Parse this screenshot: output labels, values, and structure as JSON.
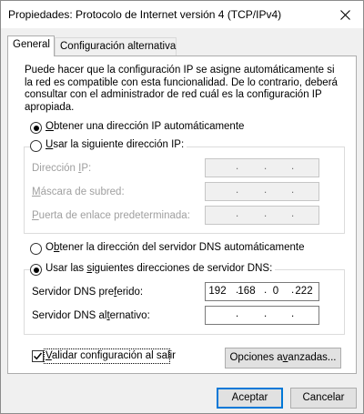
{
  "window": {
    "title": "Propiedades: Protocolo de Internet versión 4 (TCP/IPv4)"
  },
  "tabs": [
    {
      "label": "General",
      "active": true
    },
    {
      "label": "Configuración alternativa",
      "active": false
    }
  ],
  "description": "Puede hacer que la configuración IP se asigne automáticamente si la red es compatible con esta funcionalidad. De lo contrario, deberá consultar con el administrador de red cuál es la configuración IP apropiada.",
  "ip": {
    "auto_option": {
      "pre": "",
      "key": "O",
      "post": "btener una dirección IP automáticamente",
      "checked": true
    },
    "manual_option": {
      "pre": "",
      "key": "U",
      "post": "sar la siguiente dirección IP:",
      "checked": false
    },
    "fields": [
      {
        "pre": "Dirección ",
        "key": "I",
        "post": "P:",
        "value": [
          "",
          "",
          "",
          ""
        ]
      },
      {
        "pre": "",
        "key": "M",
        "post": "áscara de subred:",
        "value": [
          "",
          "",
          "",
          ""
        ]
      },
      {
        "pre": "",
        "key": "P",
        "post": "uerta de enlace predeterminada:",
        "value": [
          "",
          "",
          "",
          ""
        ]
      }
    ]
  },
  "dns": {
    "auto_option": {
      "pre": "O",
      "key": "b",
      "post": "tener la dirección del servidor DNS automáticamente",
      "checked": false
    },
    "manual_option": {
      "pre": "Usar las ",
      "key": "s",
      "post": "iguientes direcciones de servidor DNS:",
      "checked": true
    },
    "fields": [
      {
        "pre": "Servidor DNS pre",
        "key": "f",
        "post": "erido:",
        "value": [
          "192",
          "168",
          "0",
          "222"
        ]
      },
      {
        "pre": "Servidor DNS al",
        "key": "t",
        "post": "ernativo:",
        "value": [
          "",
          "",
          "",
          ""
        ]
      }
    ]
  },
  "validate": {
    "pre": "",
    "key": "V",
    "post": "alidar configuración al salir",
    "checked": true
  },
  "buttons": {
    "advanced": {
      "pre": "Opciones a",
      "key": "v",
      "post": "anzadas..."
    },
    "ok": "Aceptar",
    "cancel": "Cancelar"
  }
}
